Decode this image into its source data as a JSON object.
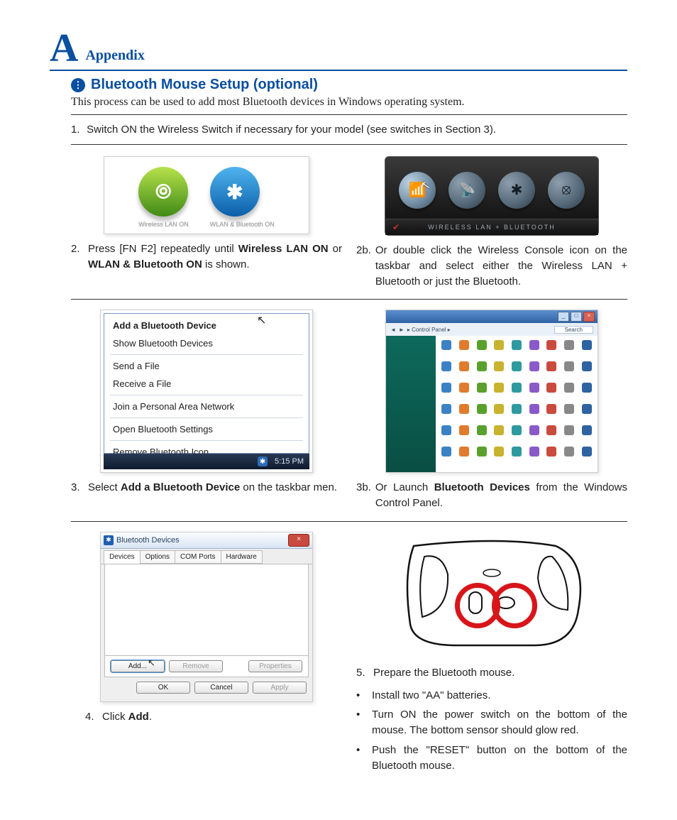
{
  "header": {
    "letter": "A",
    "label": "Appendix"
  },
  "section": {
    "title": "Bluetooth Mouse Setup (optional)",
    "intro": "This process can be used to add most Bluetooth devices in Windows operating system."
  },
  "step1": {
    "num": "1.",
    "text": "Switch ON the Wireless Switch if necessary for your model (see switches in Section 3)."
  },
  "rf_labels": {
    "wlan": "Wireless LAN ON",
    "both": "WLAN & Bluetooth ON"
  },
  "console_label": "WIRELESS LAN + BLUETOOTH",
  "step2": {
    "num": "2.",
    "pre": "Press [FN F2] repeatedly until ",
    "b1": "Wireless LAN ON",
    "mid": " or ",
    "b2": "WLAN & Bluetooth ON",
    "post": " is shown."
  },
  "step2b": {
    "num": "2b.",
    "text": "Or double click the Wireless Console icon on the taskbar and select either the Wireless LAN + Bluetooth or just the Bluetooth."
  },
  "menu": {
    "items": [
      "Add a Bluetooth Device",
      "Show Bluetooth Devices",
      "Send a File",
      "Receive a File",
      "Join a Personal Area Network",
      "Open Bluetooth Settings",
      "Remove Bluetooth Icon"
    ],
    "time": "5:15 PM"
  },
  "cp": {
    "crumb": "▸ Control Panel ▸",
    "search": "Search"
  },
  "step3": {
    "num": "3.",
    "pre": "Select ",
    "b": "Add a Bluetooth Device",
    "post": " on the taskbar men."
  },
  "step3b": {
    "num": "3b.",
    "pre": "Or Launch ",
    "b": "Bluetooth Devices",
    "post": " from the Windows Control Panel."
  },
  "btdlg": {
    "title": "Bluetooth Devices",
    "tabs": [
      "Devices",
      "Options",
      "COM Ports",
      "Hardware"
    ],
    "add": "Add...",
    "remove": "Remove",
    "props": "Properties",
    "ok": "OK",
    "cancel": "Cancel",
    "apply": "Apply"
  },
  "step4": {
    "num": "4.",
    "pre": "Click ",
    "b": "Add",
    "post": "."
  },
  "step5": {
    "num": "5.",
    "text": "Prepare the Bluetooth mouse."
  },
  "bullets": {
    "a": "Install two \"AA\" batteries.",
    "b": "Turn ON the power switch on the bottom of the mouse. The bottom sensor should glow red.",
    "c": "Push the \"RESET\" button on the bottom of the Bluetooth mouse."
  }
}
